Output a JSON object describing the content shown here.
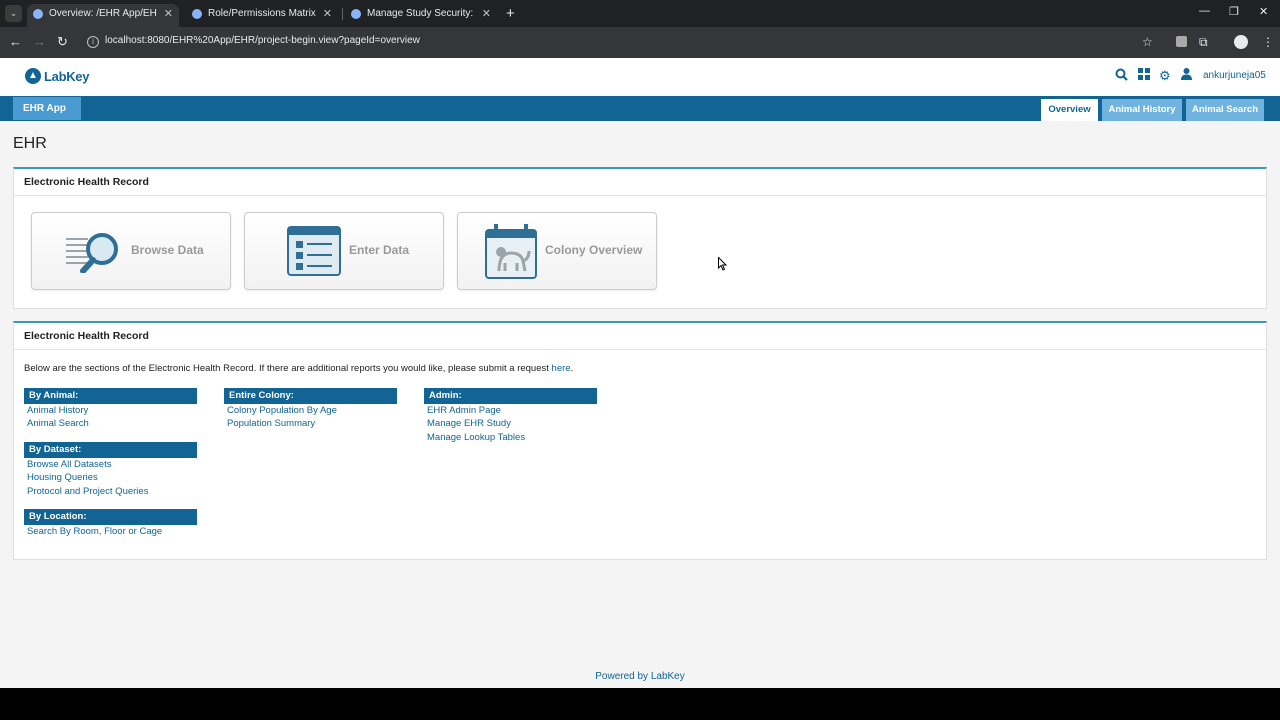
{
  "browser": {
    "tabs": [
      {
        "title": "Overview: /EHR App/EHR",
        "active": true
      },
      {
        "title": "Role/Permissions Matrix /Docu",
        "active": false
      },
      {
        "title": "Manage Study Security: /Docu",
        "active": false
      }
    ],
    "new_tab": "+",
    "url": "localhost:8080/EHR%20App/EHR/project-begin.view?pageId=overview"
  },
  "header": {
    "logo_text": "LabKey",
    "username": "ankurjuneja05"
  },
  "navbar": {
    "app_menu": "EHR App",
    "tabs": [
      "Overview",
      "Animal History",
      "Animal Search"
    ]
  },
  "page_title": "EHR",
  "panel1": {
    "heading": "Electronic Health Record",
    "tiles": [
      "Browse Data",
      "Enter Data",
      "Colony Overview"
    ]
  },
  "panel2": {
    "heading": "Electronic Health Record",
    "intro_text": "Below are the sections of the Electronic Health Record. If there are additional reports you would like, please submit a request ",
    "intro_link": "here",
    "intro_end": ".",
    "sections": {
      "by_animal": {
        "title": "By Animal:",
        "links": [
          "Animal History",
          "Animal Search"
        ]
      },
      "by_dataset": {
        "title": "By Dataset:",
        "links": [
          "Browse All Datasets",
          "Housing Queries",
          "Protocol and Project Queries"
        ]
      },
      "by_location": {
        "title": "By Location:",
        "links": [
          "Search By Room, Floor or Cage"
        ]
      },
      "entire_colony": {
        "title": "Entire Colony:",
        "links": [
          "Colony Population By Age",
          "Population Summary"
        ]
      },
      "admin": {
        "title": "Admin:",
        "links": [
          "EHR Admin Page",
          "Manage EHR Study",
          "Manage Lookup Tables"
        ]
      }
    }
  },
  "footer": "Powered by LabKey",
  "colors": {
    "brand": "#126495",
    "nav_inactive": "#6fb3de",
    "panel_accent": "#3a98b8"
  }
}
